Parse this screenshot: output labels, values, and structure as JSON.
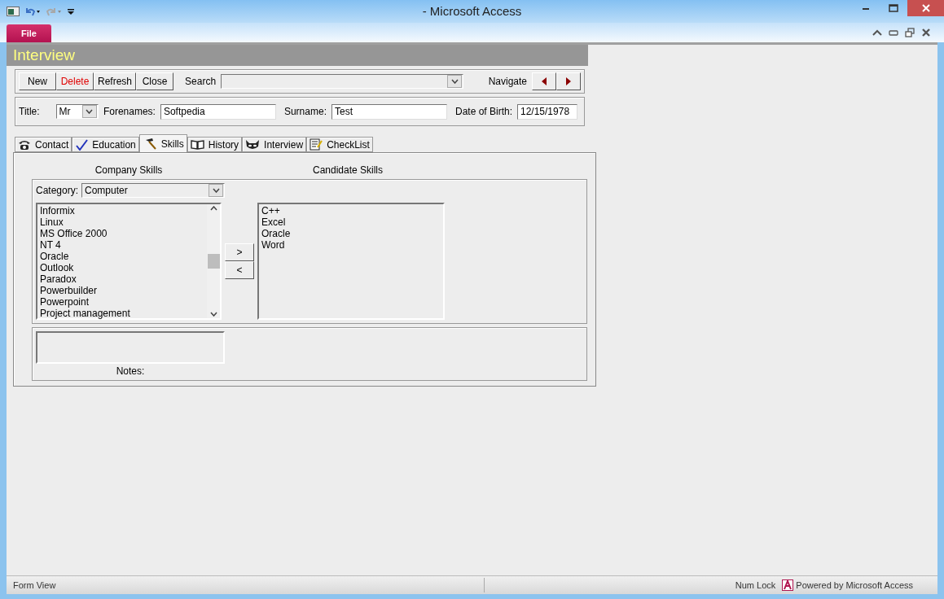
{
  "window": {
    "title": "- Microsoft Access"
  },
  "ribbon": {
    "file_tab": "File"
  },
  "form": {
    "title": "Interview",
    "toolbar": {
      "buttons": [
        {
          "label": "New",
          "kind": "normal"
        },
        {
          "label": "Delete",
          "kind": "danger"
        },
        {
          "label": "Refresh",
          "kind": "normal"
        },
        {
          "label": "Close",
          "kind": "normal"
        }
      ],
      "search_label": "Search",
      "navigate_label": "Navigate"
    },
    "fields": [
      {
        "label": "Title:",
        "value": "Mr",
        "kind": "combo"
      },
      {
        "label": "Forenames:",
        "value": "Softpedia",
        "kind": "text"
      },
      {
        "label": "Surname:",
        "value": "Test",
        "kind": "text"
      },
      {
        "label": "Date of Birth:",
        "value": "12/15/1978",
        "kind": "text"
      }
    ],
    "tabs": [
      {
        "label": "Contact",
        "selected": false
      },
      {
        "label": "Education",
        "selected": false
      },
      {
        "label": "Skills",
        "selected": true
      },
      {
        "label": "History",
        "selected": false
      },
      {
        "label": "Interview",
        "selected": false
      },
      {
        "label": "CheckList",
        "selected": false
      }
    ],
    "skills": {
      "company_heading": "Company Skills",
      "candidate_heading": "Candidate Skills",
      "category_label": "Category:",
      "category_value": "Computer",
      "company_list": [
        "Informix",
        "Linux",
        "MS Office 2000",
        "NT 4",
        "Oracle",
        "Outlook",
        "Paradox",
        "Powerbuilder",
        "Powerpoint",
        "Project management"
      ],
      "move_buttons": [
        ">",
        "<"
      ],
      "candidate_list": [
        "C++",
        "Excel",
        "Oracle",
        "Word"
      ],
      "notes_label": "Notes:"
    }
  },
  "status_bar": {
    "view": "Form View",
    "num_lock": "Num Lock",
    "powered_by": "Powered by Microsoft Access"
  }
}
